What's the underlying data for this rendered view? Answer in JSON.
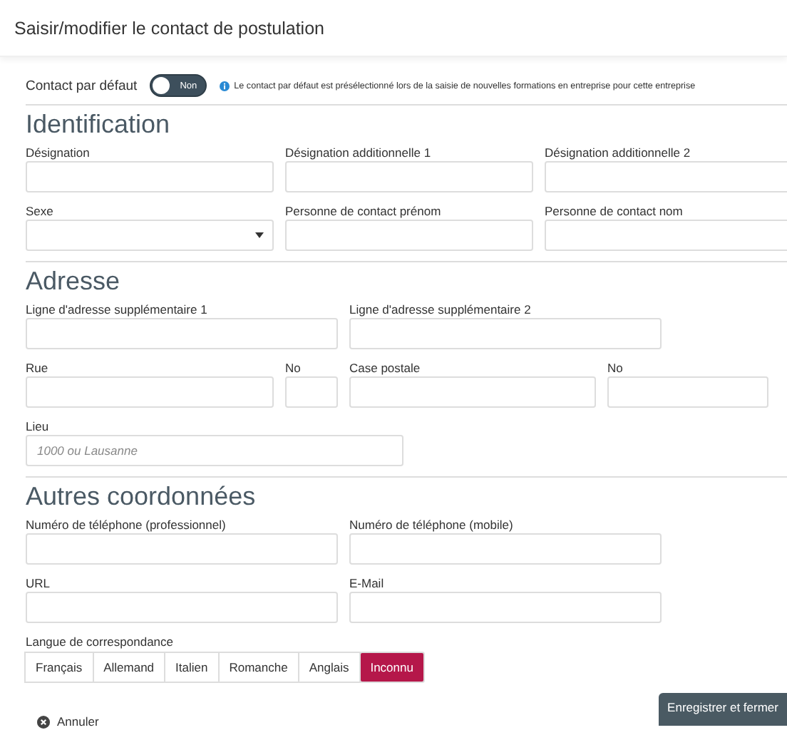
{
  "dialog": {
    "title": "Saisir/modifier le contact de postulation"
  },
  "default_contact": {
    "label": "Contact par défaut",
    "on": false,
    "toggle_text": "Non",
    "info": "Le contact par défaut est présélectionné lors de la saisie de nouvelles formations en entreprise pour cette entreprise"
  },
  "sections": [
    {
      "title": "Identification",
      "rows": [
        [
          {
            "label": "Désignation",
            "kind": "text"
          },
          {
            "label": "Désignation additionnelle 1",
            "kind": "text"
          },
          {
            "label": "Désignation additionnelle 2",
            "kind": "text"
          }
        ],
        [
          {
            "label": "Sexe",
            "kind": "select"
          },
          {
            "label": "Personne de contact prénom",
            "kind": "text"
          },
          {
            "label": "Personne de contact nom",
            "kind": "text"
          }
        ]
      ]
    },
    {
      "title": "Adresse",
      "rows": [
        [
          {
            "label": "Ligne d'adresse supplémentaire 1",
            "kind": "text"
          },
          {
            "label": "Ligne d'adresse supplémentaire 2",
            "kind": "text"
          }
        ],
        [
          {
            "kind": "group",
            "fields": [
              {
                "label": "Rue",
                "kind": "text"
              },
              {
                "label": "No",
                "kind": "text"
              }
            ]
          },
          {
            "kind": "group",
            "fields": [
              {
                "label": "Case postale",
                "kind": "text"
              },
              {
                "label": "No",
                "kind": "text"
              }
            ]
          }
        ],
        [
          {
            "label": "Lieu",
            "kind": "text",
            "placeholder": "1000 ou Lausanne"
          }
        ]
      ]
    },
    {
      "title": "Autres coordonnées",
      "rows": [
        [
          {
            "label": "Numéro de téléphone (professionnel)",
            "kind": "text"
          },
          {
            "label": "Numéro de téléphone (mobile)",
            "kind": "text"
          }
        ],
        [
          {
            "label": "URL",
            "kind": "text"
          },
          {
            "label": "E-Mail",
            "kind": "text"
          }
        ]
      ]
    }
  ],
  "language": {
    "label": "Langue de correspondance",
    "options": [
      {
        "label": "Français",
        "selected": false
      },
      {
        "label": "Allemand",
        "selected": false
      },
      {
        "label": "Italien",
        "selected": false
      },
      {
        "label": "Romanche",
        "selected": false
      },
      {
        "label": "Anglais",
        "selected": false
      },
      {
        "label": "Inconnu",
        "selected": true
      }
    ]
  },
  "footer": {
    "cancel": "Annuler",
    "save": "Enregistrer et fermer"
  }
}
